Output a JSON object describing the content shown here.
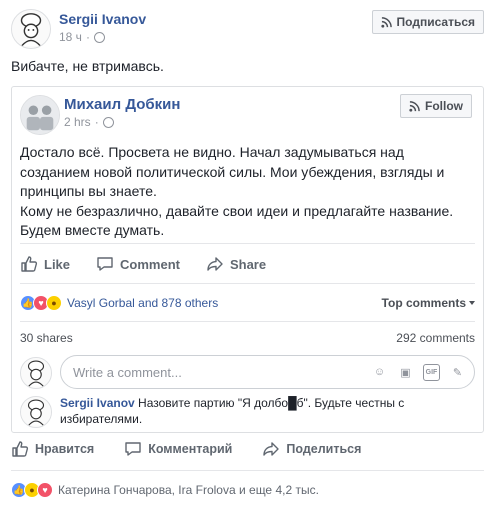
{
  "post": {
    "author": "Sergii Ivanov",
    "time": "18 ч",
    "subscribe_label": "Подписаться",
    "text": "Вибачте, не втримавсь."
  },
  "shared": {
    "author": "Михаил Добкин",
    "time": "2 hrs",
    "follow_label": "Follow",
    "paragraphs": [
      "Достало всё. Просвета не видно. Начал задумываться над созданием новой политической силы. Мои убеждения, взгляды и принципы вы знаете.",
      "Кому не безразлично, давайте свои идеи и предлагайте название. Будем вместе думать."
    ],
    "actions": {
      "like": "Like",
      "comment": "Comment",
      "share": "Share"
    },
    "reactions_text": "Vasyl Gorbal and 878 others",
    "top_comments_label": "Top comments",
    "shares": "30 shares",
    "comments_count": "292 comments",
    "comment_placeholder": "Write a comment...",
    "comment": {
      "author": "Sergii Ivanov",
      "text": "Назовите партию \"Я долбо█б\". Будьте честны с избирателями."
    }
  },
  "outer_actions": {
    "like": "Нравится",
    "comment": "Комментарий",
    "share": "Поделиться"
  },
  "outer_reactions_text": "Катерина Гончарова, Ira Frolova и еще 4,2 тыс.",
  "colors": {
    "link": "#365899",
    "like": "#5890ff",
    "love": "#f25268",
    "wow": "#fcd000"
  }
}
